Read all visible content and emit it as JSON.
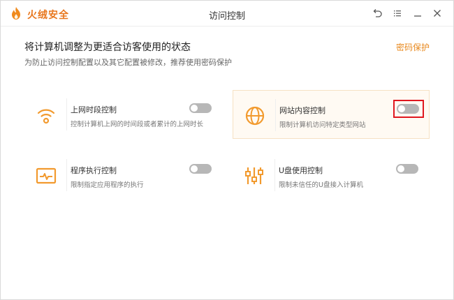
{
  "app": {
    "brand": "火绒安全",
    "window_title": "访问控制"
  },
  "header": {
    "title": "将计算机调整为更适合访客使用的状态",
    "subtitle": "为防止访问控制配置以及其它配置被修改，推荐使用密码保护",
    "password_link": "密码保护"
  },
  "cards": [
    {
      "title": "上网时段控制",
      "desc": "控制计算机上网的时间段或者累计的上网时长",
      "enabled": false,
      "icon": "wifi-icon"
    },
    {
      "title": "网站内容控制",
      "desc": "限制计算机访问特定类型网站",
      "enabled": false,
      "icon": "globe-icon"
    },
    {
      "title": "程序执行控制",
      "desc": "限制指定应用程序的执行",
      "enabled": false,
      "icon": "monitor-pulse-icon"
    },
    {
      "title": "U盘使用控制",
      "desc": "限制未信任的U盘接入计算机",
      "enabled": false,
      "icon": "usb-icon"
    }
  ],
  "colors": {
    "accent": "#e8891e",
    "brand": "#e8771e",
    "toggle_off": "#b7b7b7",
    "highlight": "#e0171f"
  }
}
